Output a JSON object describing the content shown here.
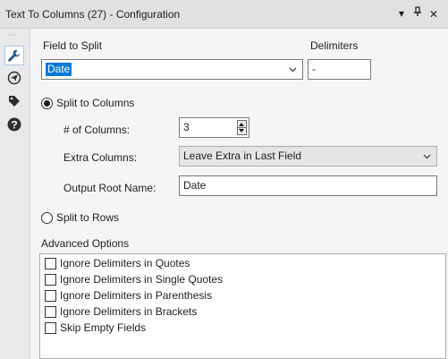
{
  "window": {
    "title": "Text To Columns (27) - Configuration",
    "btn_dropdown": "▾",
    "btn_pin": "⫧",
    "btn_close": "✕"
  },
  "sidebar": {
    "grip": "⋯",
    "items": [
      {
        "icon": "wrench-icon",
        "active": true
      },
      {
        "icon": "navigator-icon",
        "active": false
      },
      {
        "icon": "tag-icon",
        "active": false
      },
      {
        "icon": "help-icon",
        "active": false
      }
    ]
  },
  "field_to_split": {
    "label": "Field to Split",
    "value": "Date"
  },
  "delimiters": {
    "label": "Delimiters",
    "value": "-"
  },
  "split_to_columns": {
    "label": "Split to Columns",
    "selected": true,
    "num_columns_label": "# of Columns:",
    "num_columns_value": "3",
    "extra_columns_label": "Extra Columns:",
    "extra_columns_value": "Leave Extra in Last Field",
    "output_root_label": "Output Root Name:",
    "output_root_value": "Date"
  },
  "split_to_rows": {
    "label": "Split to Rows",
    "selected": false
  },
  "advanced_options": {
    "label": "Advanced Options",
    "items": [
      {
        "label": "Ignore Delimiters in Quotes",
        "checked": false
      },
      {
        "label": "Ignore Delimiters in Single Quotes",
        "checked": false
      },
      {
        "label": "Ignore Delimiters in Parenthesis",
        "checked": false
      },
      {
        "label": "Ignore Delimiters in Brackets",
        "checked": false
      },
      {
        "label": "Skip Empty Fields",
        "checked": false
      }
    ]
  },
  "colors": {
    "selection": "#0078d7",
    "titlebar": "#e1e1e1",
    "panel": "#f5f5f5"
  }
}
